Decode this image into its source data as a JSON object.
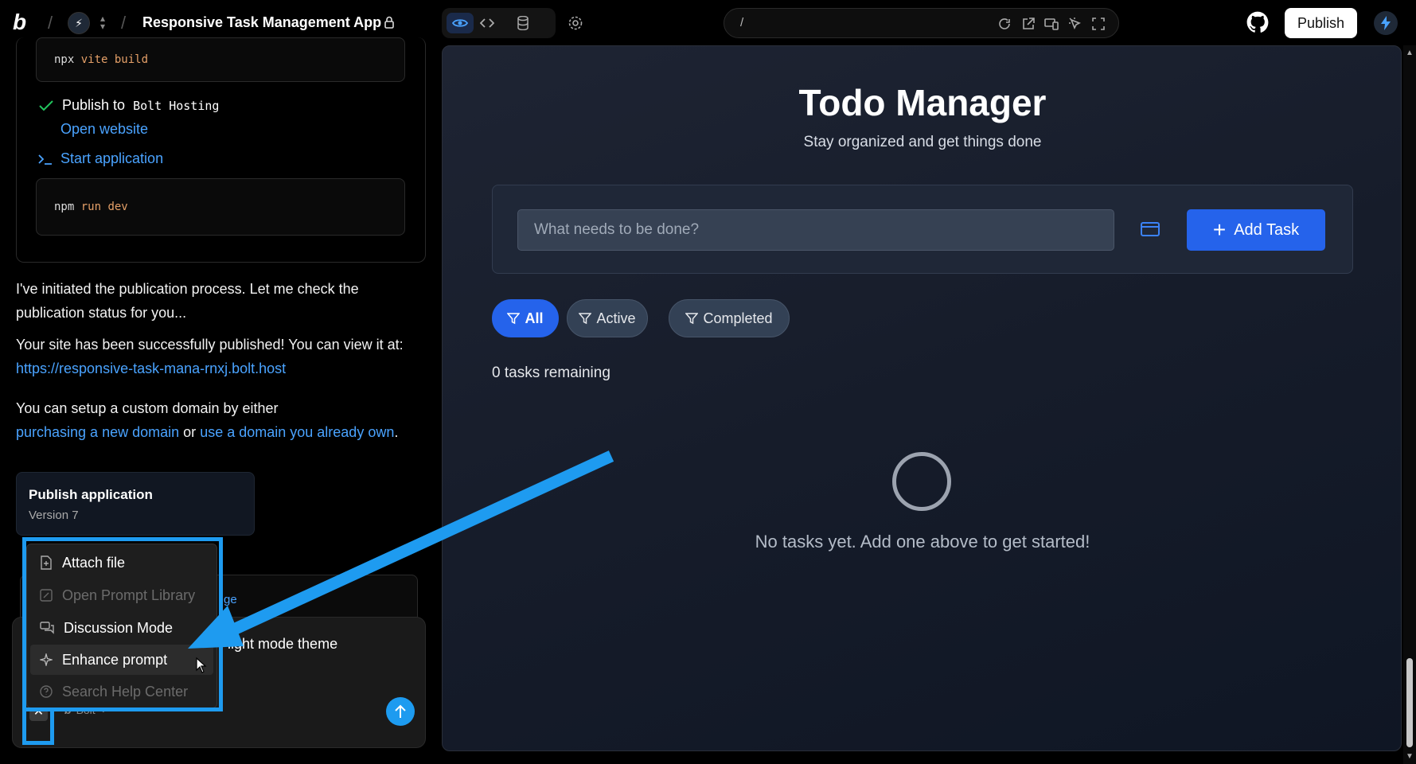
{
  "header": {
    "logo": "b",
    "project_title": "Responsive Task Management App",
    "address_path": "/",
    "publish_label": "Publish"
  },
  "chat": {
    "code_build": {
      "cmd": "npx",
      "rest": "vite build"
    },
    "publish_step": {
      "label": "Publish to",
      "target": "Bolt Hosting"
    },
    "open_website": "Open website",
    "start_application": "Start application",
    "code_dev": {
      "cmd": "npm",
      "rest": "run dev"
    },
    "msg1": "I've initiated the publication process. Let me check the publication status for you...",
    "msg2_text": "Your site has been successfully published! You can view it at:",
    "msg2_link": "https://responsive-task-mana-rnxj.bolt.host",
    "msg3_text": "You can setup a custom domain by either",
    "msg3_link1": "purchasing a new domain",
    "msg3_or": "or",
    "msg3_link2": "use a domain you already own",
    "msg3_end": ".",
    "publish_card": {
      "title": "Publish application",
      "version": "Version 7"
    },
    "ghost_hint": "ge",
    "prompt_text": "light mode theme",
    "model": "Bolt",
    "close_glyph": "✕"
  },
  "menu": {
    "items": [
      {
        "label": "Attach file",
        "enabled": true,
        "icon": "file-plus-icon"
      },
      {
        "label": "Open Prompt Library",
        "enabled": false,
        "icon": "prompt-library-icon"
      },
      {
        "label": "Discussion Mode",
        "enabled": true,
        "icon": "chat-bubbles-icon"
      },
      {
        "label": "Enhance prompt",
        "enabled": true,
        "icon": "sparkle-icon"
      },
      {
        "label": "Search Help Center",
        "enabled": false,
        "icon": "help-circle-icon"
      }
    ]
  },
  "preview": {
    "title": "Todo Manager",
    "subtitle": "Stay organized and get things done",
    "input_placeholder": "What needs to be done?",
    "add_label": "Add Task",
    "filters": [
      "All",
      "Active",
      "Completed"
    ],
    "active_filter": "All",
    "remaining": "0 tasks remaining",
    "empty_message": "No tasks yet. Add one above to get started!"
  },
  "colors": {
    "accent": "#2563eb",
    "annotation": "#1e9bf0",
    "link": "#4aa3ff"
  }
}
